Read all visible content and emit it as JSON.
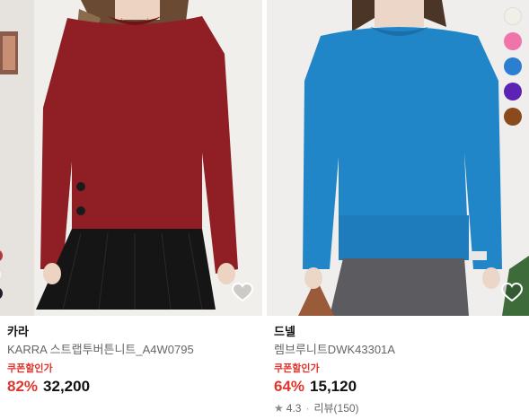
{
  "products": [
    {
      "brand": "카라",
      "name": "KARRA 스트랩투버튼니트_A4W0795",
      "coupon_label": "쿠폰할인가",
      "discount": "82%",
      "price": "32,200",
      "swatch_colors": [
        "#b43a3a",
        "#f4f0ea",
        "#1f1f2b"
      ]
    },
    {
      "brand": "드넬",
      "name": "렘브루니트DWK43301A",
      "coupon_label": "쿠폰할인가",
      "discount": "64%",
      "price": "15,120",
      "rating": "4.3",
      "review_separator": "·",
      "reviews": "리뷰(150)",
      "swatch_colors": [
        "#f2efe6",
        "#f074a9",
        "#2a7fd0",
        "#5b22b3",
        "#8b4a1c"
      ]
    }
  ]
}
